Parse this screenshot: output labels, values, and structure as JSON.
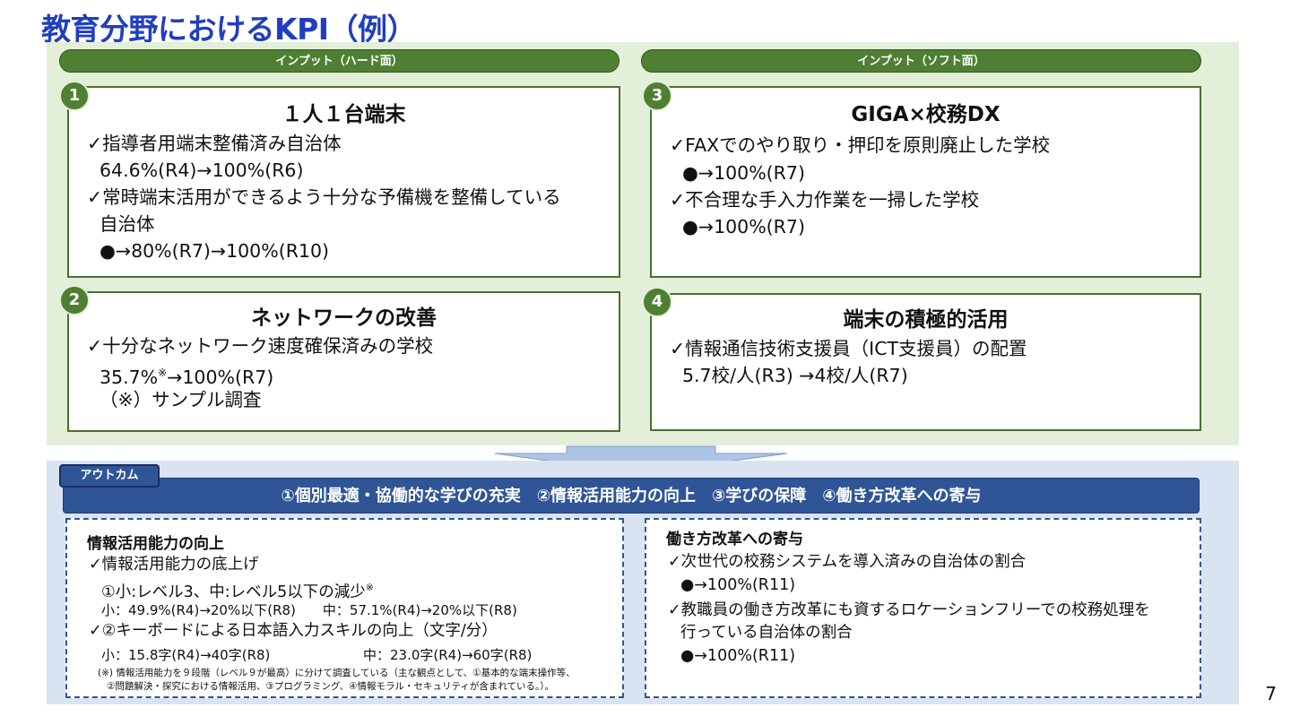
{
  "title": "教育分野におけるKPI（例）",
  "input_hard_label": "インプット（ハード面）",
  "input_soft_label": "インプット（ソフト面）",
  "box1": {
    "num": "1",
    "title": "１人１台端末",
    "l1": "✓指導者用端末整備済み自治体",
    "l2": "64.6%(R4)→100%(R6)",
    "l3": "✓常時端末活用ができるよう十分な予備機を整備している",
    "l4": "自治体",
    "l5": "●→80%(R7)→100%(R10)"
  },
  "box2": {
    "num": "2",
    "title": "ネットワークの改善",
    "l1": "✓十分なネットワーク速度確保済みの学校",
    "l2a": "35.7%",
    "l2sup": "※",
    "l2b": "→100%(R7)",
    "l3": "（※）サンプル調査"
  },
  "box3": {
    "num": "3",
    "title": "GIGA×校務DX",
    "l1": "✓FAXでのやり取り・押印を原則廃止した学校",
    "l2": "●→100%(R7)",
    "l3": "✓不合理な手入力作業を一掃した学校",
    "l4": "●→100%(R7)"
  },
  "box4": {
    "num": "4",
    "title": "端末の積極的活用",
    "l1": "✓情報通信技術支援員（ICT支援員）の配置",
    "l2": "5.7校/人(R3) →4校/人(R7)"
  },
  "outcome": {
    "tab": "アウトカム",
    "bar": "①個別最適・協働的な学びの充実　②情報活用能力の向上　③学びの保障　④働き方改革への寄与"
  },
  "left_panel": {
    "heading": "情報活用能力の向上",
    "l1": "✓情報活用能力の底上げ",
    "l2a": "①小:レベル3、中:レベル5以下の減少",
    "l2sup": "※",
    "l3": "小：49.9%(R4)→20%以下(R8)　　中：57.1%(R4)→20%以下(R8)",
    "l4": "✓②キーボードによる日本語入力スキルの向上（文字/分）",
    "l5a": "小：15.8字(R4)→40字(R8)",
    "l5b": "中：23.0字(R4)→60字(R8)",
    "note1": "(※) 情報活用能力を９段階（レベル９が最高）に分けて調査している（主な観点として、①基本的な端末操作等、",
    "note2": "②問題解決・探究における情報活用、③プログラミング、④情報モラル・セキュリティが含まれている。）。"
  },
  "right_panel": {
    "heading": "働き方改革への寄与",
    "l1": "✓次世代の校務システムを導入済みの自治体の割合",
    "l2": "●→100%(R11)",
    "l3": "✓教職員の働き方改革にも資するロケーションフリーでの校務処理を",
    "l4": "行っている自治体の割合",
    "l5": "●→100%(R11)"
  },
  "page_number": "7",
  "colors": {
    "title": "#1f3fbf",
    "green": "#4f7f33",
    "green_bg": "#e3efd9",
    "blue": "#2f5597",
    "blue_bg": "#d9e4f2"
  }
}
